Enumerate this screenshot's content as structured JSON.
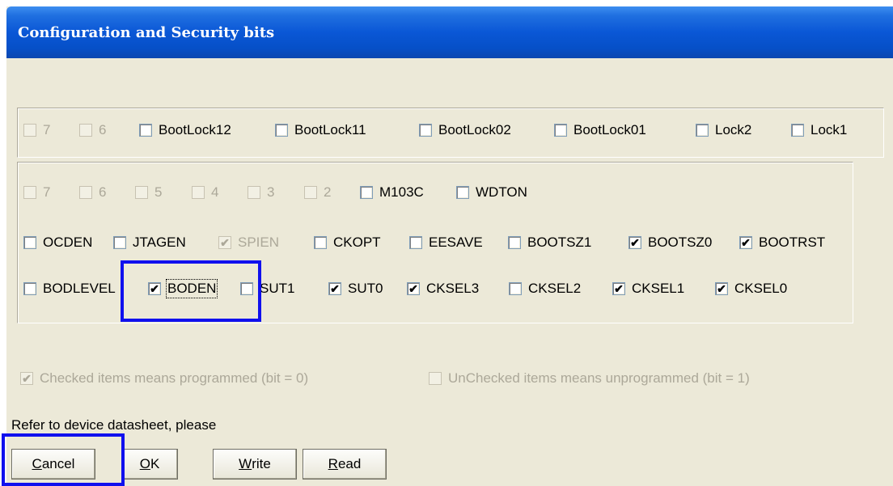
{
  "window": {
    "title": "Configuration and Security bits"
  },
  "lock_bits": [
    {
      "label": "7",
      "checked": false,
      "enabled": false
    },
    {
      "label": "6",
      "checked": false,
      "enabled": false
    },
    {
      "label": "BootLock12",
      "checked": false,
      "enabled": true
    },
    {
      "label": "BootLock11",
      "checked": false,
      "enabled": true
    },
    {
      "label": "BootLock02",
      "checked": false,
      "enabled": true
    },
    {
      "label": "BootLock01",
      "checked": false,
      "enabled": true
    },
    {
      "label": "Lock2",
      "checked": false,
      "enabled": true
    },
    {
      "label": "Lock1",
      "checked": false,
      "enabled": true
    }
  ],
  "fuse_row1": [
    {
      "label": "7",
      "checked": false,
      "enabled": false
    },
    {
      "label": "6",
      "checked": false,
      "enabled": false
    },
    {
      "label": "5",
      "checked": false,
      "enabled": false
    },
    {
      "label": "4",
      "checked": false,
      "enabled": false
    },
    {
      "label": "3",
      "checked": false,
      "enabled": false
    },
    {
      "label": "2",
      "checked": false,
      "enabled": false
    },
    {
      "label": "M103C",
      "checked": false,
      "enabled": true
    },
    {
      "label": "WDTON",
      "checked": false,
      "enabled": true
    }
  ],
  "fuse_row2": [
    {
      "label": "OCDEN",
      "checked": false,
      "enabled": true
    },
    {
      "label": "JTAGEN",
      "checked": false,
      "enabled": true
    },
    {
      "label": "SPIEN",
      "checked": true,
      "enabled": false
    },
    {
      "label": "CKOPT",
      "checked": false,
      "enabled": true
    },
    {
      "label": "EESAVE",
      "checked": false,
      "enabled": true
    },
    {
      "label": "BOOTSZ1",
      "checked": false,
      "enabled": true
    },
    {
      "label": "BOOTSZ0",
      "checked": true,
      "enabled": true
    },
    {
      "label": "BOOTRST",
      "checked": true,
      "enabled": true
    }
  ],
  "fuse_row3": [
    {
      "label": "BODLEVEL",
      "checked": false,
      "enabled": true
    },
    {
      "label": "BODEN",
      "checked": true,
      "enabled": true
    },
    {
      "label": "SUT1",
      "checked": false,
      "enabled": true
    },
    {
      "label": "SUT0",
      "checked": true,
      "enabled": true
    },
    {
      "label": "CKSEL3",
      "checked": true,
      "enabled": true
    },
    {
      "label": "CKSEL2",
      "checked": false,
      "enabled": true
    },
    {
      "label": "CKSEL1",
      "checked": true,
      "enabled": true
    },
    {
      "label": "CKSEL0",
      "checked": true,
      "enabled": true
    }
  ],
  "legend": {
    "checked": {
      "label": "Checked items means programmed (bit = 0)",
      "checked": true
    },
    "unchecked": {
      "label": "UnChecked items means unprogrammed (bit = 1)",
      "checked": false
    }
  },
  "note": "Refer to device datasheet, please",
  "buttons": {
    "cancel": {
      "mnemonic": "C",
      "rest": "ancel"
    },
    "ok": {
      "mnemonic": "O",
      "rest": "K"
    },
    "write": {
      "mnemonic": "W",
      "rest": "rite"
    },
    "read": {
      "mnemonic": "R",
      "rest": "ead"
    }
  },
  "highlight_color": "#1010ee",
  "check_glyph": "✔"
}
